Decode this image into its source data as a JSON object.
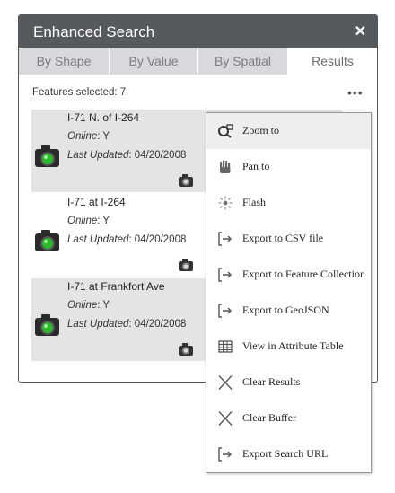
{
  "panel": {
    "title": "Enhanced Search",
    "close_label": "✕",
    "tabs": [
      "By Shape",
      "By Value",
      "By Spatial",
      "Results"
    ],
    "active_tab": "Results",
    "features_selected": "Features selected: 7",
    "more_label": "•••"
  },
  "results": [
    {
      "name": "I-71 N. of I-264",
      "online_label": "Online",
      "online_value": ": Y",
      "updated_label": "Last Updated",
      "updated_value": ": 04/20/2008"
    },
    {
      "name": "I-71 at I-264",
      "online_label": "Online",
      "online_value": ": Y",
      "updated_label": "Last Updated",
      "updated_value": ": 04/20/2008"
    },
    {
      "name": "I-71 at Frankfort Ave",
      "online_label": "Online",
      "online_value": ": Y",
      "updated_label": "Last Updated",
      "updated_value": ": 04/20/2008"
    }
  ],
  "menu": {
    "items": [
      {
        "label": "Zoom to",
        "icon": "zoom-to-icon"
      },
      {
        "label": "Pan to",
        "icon": "pan-hand-icon"
      },
      {
        "label": "Flash",
        "icon": "flash-icon"
      },
      {
        "label": "Export to CSV file",
        "icon": "export-icon"
      },
      {
        "label": "Export to Feature Collection",
        "icon": "export-icon"
      },
      {
        "label": "Export to GeoJSON",
        "icon": "export-icon"
      },
      {
        "label": "View in Attribute Table",
        "icon": "table-icon"
      },
      {
        "label": "Clear Results",
        "icon": "clear-x-icon"
      },
      {
        "label": "Clear Buffer",
        "icon": "clear-x-icon"
      },
      {
        "label": "Export Search URL",
        "icon": "export-icon"
      }
    ]
  },
  "colors": {
    "titlebar": "#555a5f",
    "tab_bg": "#d7d9dc",
    "result_shade": "#e4e4e4",
    "camera_lens": "#2db82d",
    "menu_highlight": "#eeeeee"
  }
}
